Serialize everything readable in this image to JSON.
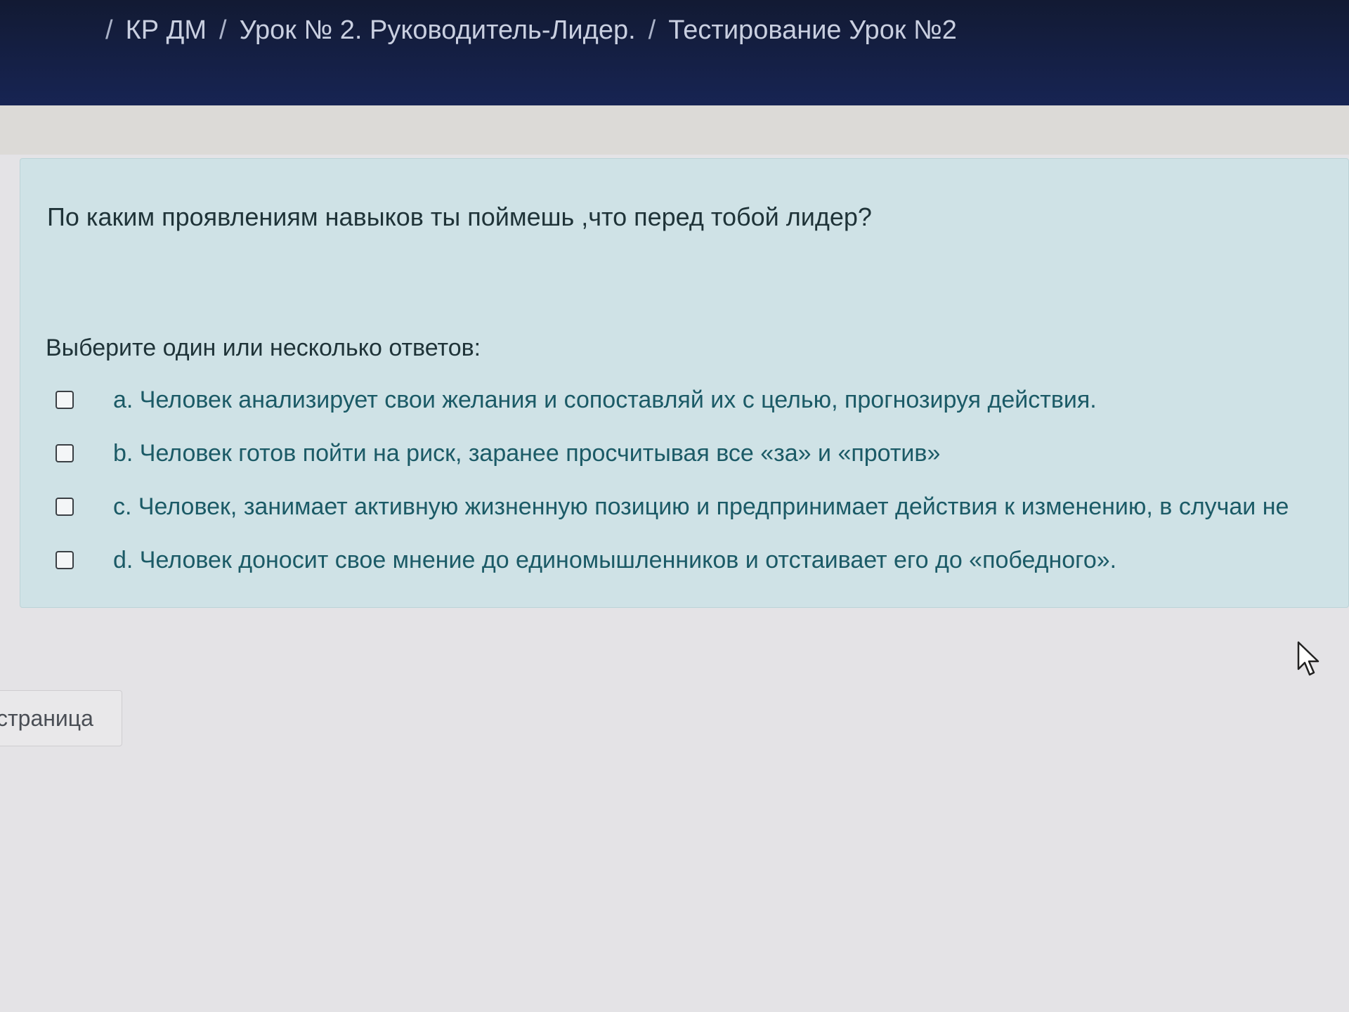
{
  "breadcrumb": {
    "separator": "/",
    "items": [
      {
        "label": "КР ДМ"
      },
      {
        "label": "Урок № 2. Руководитель-Лидер."
      },
      {
        "label": "Тестирование Урок №2"
      }
    ]
  },
  "question": {
    "text": "По каким проявлениям навыков ты поймешь ,что перед тобой лидер?",
    "prompt": "Выберите один или несколько ответов:",
    "answers": [
      {
        "label": "a. Человек  анализирует свои желания и сопоставляй их с целью, прогнозируя действия.",
        "checked": false
      },
      {
        "label": "b. Человек готов пойти на риск, заранее просчитывая все «за» и «против»",
        "checked": false
      },
      {
        "label": "c. Человек, занимает активную жизненную позицию и предпринимает действия к изменению, в случаи не",
        "checked": false
      },
      {
        "label": "d. Человек доносит свое мнение до единомышленников и отстаивает его до «победного».",
        "checked": false
      }
    ]
  },
  "navigation": {
    "page_button_label": "страница"
  },
  "colors": {
    "header_bg": "#172453",
    "card_bg": "#cfe2e6",
    "answer_text": "#1b5a66",
    "page_bg": "#e4e3e6"
  },
  "icons": {
    "cursor": "mouse-pointer-icon"
  }
}
